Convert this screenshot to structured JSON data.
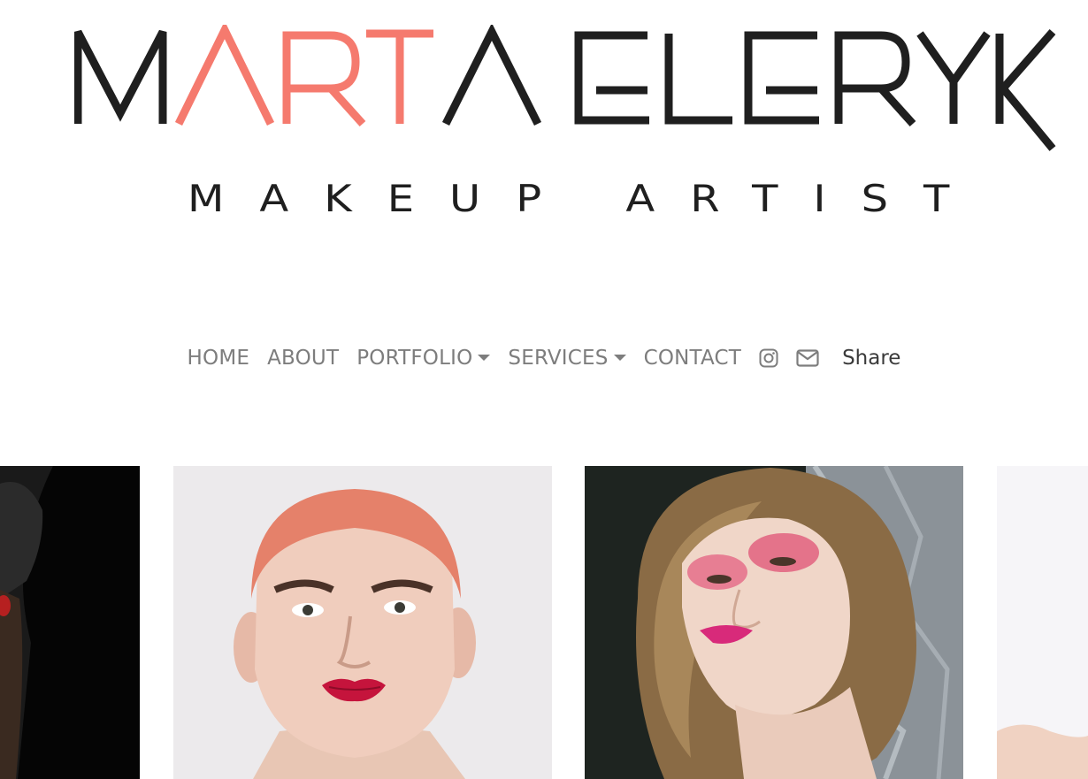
{
  "logo": {
    "name_first": "MARTA",
    "name_first_highlight": "ART",
    "name_last": "ELERYK",
    "tagline": "MAKEUP ARTIST",
    "accent_color": "#f57a6e",
    "ink_color": "#1f1f1f"
  },
  "nav": {
    "items": [
      {
        "label": "HOME",
        "has_dropdown": false
      },
      {
        "label": "ABOUT",
        "has_dropdown": false
      },
      {
        "label": "PORTFOLIO",
        "has_dropdown": true
      },
      {
        "label": "SERVICES",
        "has_dropdown": true
      },
      {
        "label": "CONTACT",
        "has_dropdown": false
      }
    ],
    "icons": [
      "instagram-icon",
      "envelope-icon"
    ],
    "share_label": "Share",
    "text_color": "#7d7d7d"
  },
  "gallery": {
    "photos": [
      {
        "description": "model-dark-hair-black-background"
      },
      {
        "description": "model-red-hair-pink-lips"
      },
      {
        "description": "model-bob-hair-pink-eyeshadow"
      },
      {
        "description": "model-light-background"
      }
    ]
  }
}
